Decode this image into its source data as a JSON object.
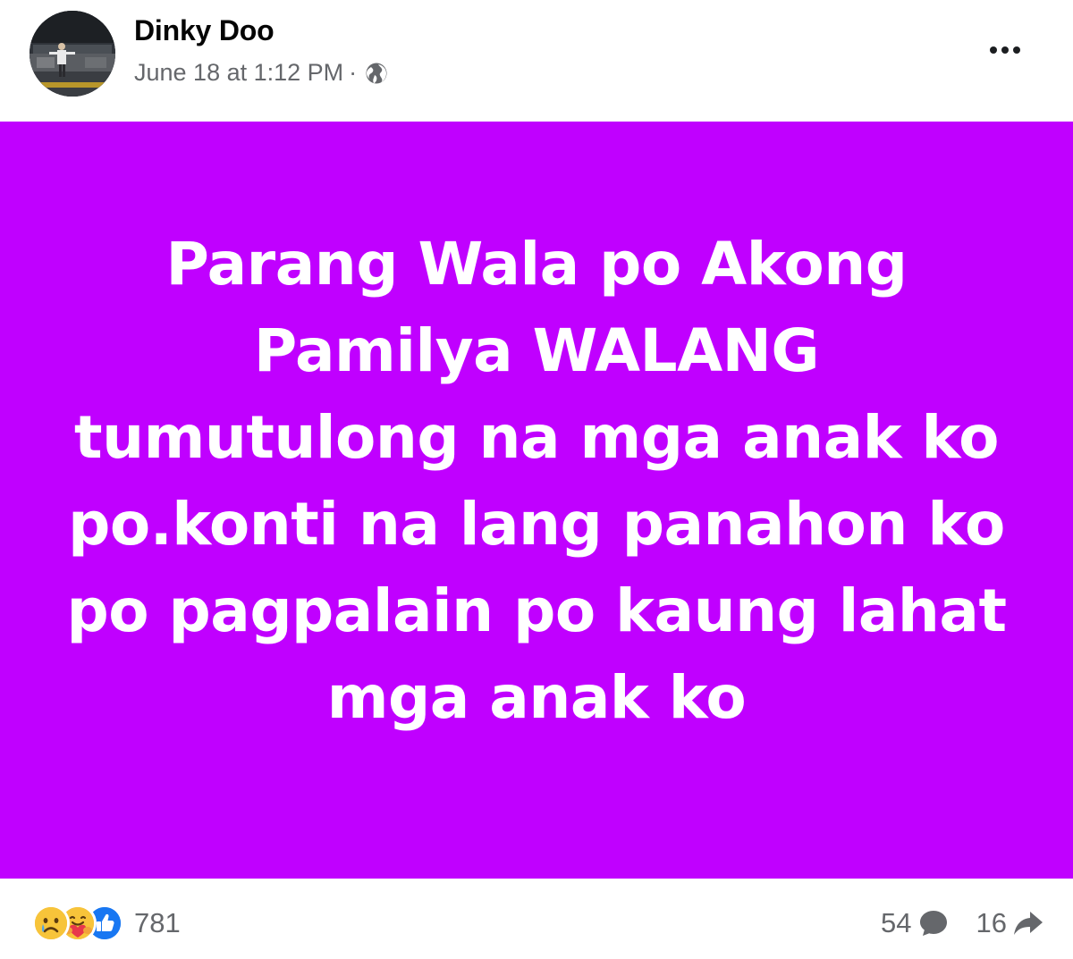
{
  "post": {
    "author": "Dinky Doo",
    "timestamp": "June 18 at 1:12 PM",
    "separator": "·",
    "privacy_icon": "globe-icon",
    "more_icon": "more-options-icon",
    "background_color": "#c000ff",
    "text_color": "#ffffff",
    "text": "Parang Wala po Akong Pamilya WALANG tumutulong na mga anak ko po.konti na lang panahon ko po pagpalain po kaung lahat mga anak ko"
  },
  "footer": {
    "reaction_icons": [
      "sad-reaction-icon",
      "care-reaction-icon",
      "like-reaction-icon"
    ],
    "reaction_count": "781",
    "comment_count": "54",
    "comment_icon": "comment-icon",
    "share_count": "16",
    "share_icon": "share-icon"
  }
}
